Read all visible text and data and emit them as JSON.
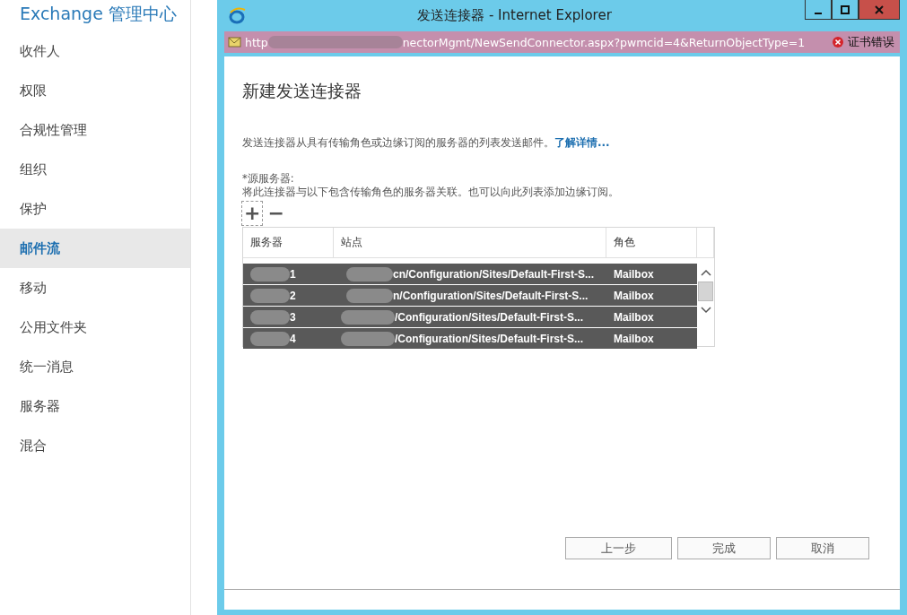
{
  "app_title": "Exchange 管理中心",
  "sidebar": {
    "items": [
      {
        "label": "收件人",
        "selected": false
      },
      {
        "label": "权限",
        "selected": false
      },
      {
        "label": "合规性管理",
        "selected": false
      },
      {
        "label": "组织",
        "selected": false
      },
      {
        "label": "保护",
        "selected": false
      },
      {
        "label": "邮件流",
        "selected": true
      },
      {
        "label": "移动",
        "selected": false
      },
      {
        "label": "公用文件夹",
        "selected": false
      },
      {
        "label": "统一消息",
        "selected": false
      },
      {
        "label": "服务器",
        "selected": false
      },
      {
        "label": "混合",
        "selected": false
      }
    ]
  },
  "window": {
    "title": "发送连接器 - Internet Explorer",
    "address_start": "http",
    "address_end": "nectorMgmt/NewSendConnector.aspx?pwmcid=4&ReturnObjectType=1",
    "certificate_error": "证书错误"
  },
  "dialog": {
    "heading": "新建发送连接器",
    "description": "发送连接器从具有传输角色或边缘订阅的服务器的列表发送邮件。",
    "learn_more": "了解详情...",
    "field_label": "*源服务器:",
    "field_help": "将此连接器与以下包含传输角色的服务器关联。也可以向此列表添加边缘订阅。",
    "toolbar": [
      "+",
      "−"
    ],
    "table": {
      "columns": [
        "服务器",
        "站点",
        "角色"
      ],
      "rows": [
        {
          "server": "1",
          "site": "cn/Configuration/Sites/Default-First-S...",
          "role": "Mailbox",
          "selected": true
        },
        {
          "server": "2",
          "site": "n/Configuration/Sites/Default-First-S...",
          "role": "Mailbox",
          "selected": true
        },
        {
          "server": "3",
          "site": "/Configuration/Sites/Default-First-S...",
          "role": "Mailbox",
          "selected": true
        },
        {
          "server": "4",
          "site": "/Configuration/Sites/Default-First-S...",
          "role": "Mailbox",
          "selected": true
        }
      ]
    },
    "buttons": [
      "上一步",
      "完成",
      "取消"
    ]
  }
}
